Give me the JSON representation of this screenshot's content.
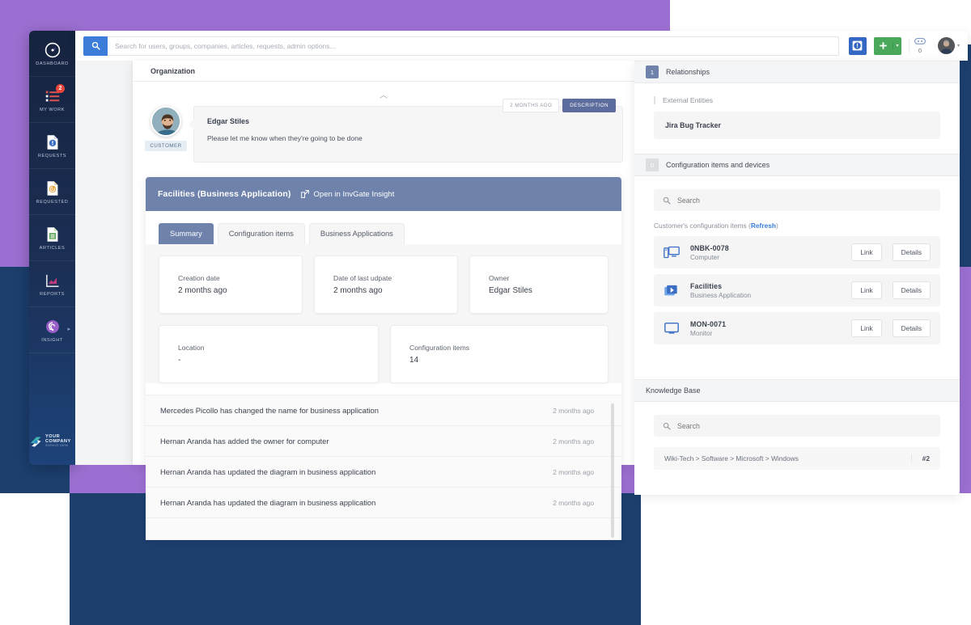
{
  "colors": {
    "bg_purple": "#9b6fd1",
    "bg_navy": "#1c3f6e",
    "accent_blue": "#3b7dd8",
    "panel_header_blue": "#6e82ab",
    "add_green": "#4aa85a",
    "badge_red": "#e8443a"
  },
  "sidebar": {
    "items": [
      {
        "label": "DASHBOARD",
        "icon": "speedometer-icon",
        "badge": null
      },
      {
        "label": "MY WORK",
        "icon": "task-list-icon",
        "badge": "2"
      },
      {
        "label": "REQUESTS",
        "icon": "request-document-icon",
        "badge": null
      },
      {
        "label": "REQUESTED",
        "icon": "requested-document-icon",
        "badge": null
      },
      {
        "label": "ARTICLES",
        "icon": "article-document-icon",
        "badge": null
      },
      {
        "label": "REPORTS",
        "icon": "chart-report-icon",
        "badge": null
      },
      {
        "label": "INSIGHT",
        "icon": "insight-circle-icon",
        "badge": null
      }
    ],
    "company": {
      "name": "YOUR COMPANY",
      "tagline": "SERVICE DESK",
      "logo": "company-logo-icon"
    }
  },
  "topbar": {
    "search_placeholder": "Search for users, groups, companies, articles, requests, admin options...",
    "search_value": "",
    "search_icon": "search-icon",
    "info_button": "info-icon",
    "add_button": "plus-icon",
    "add_caret": "▾",
    "chat_icon": "chat-bubble-icon",
    "chat_count": "0",
    "avatar": "user-avatar",
    "avatar_caret": "▾"
  },
  "main": {
    "organization_label": "Organization",
    "collapse_icon": "chevron-up-icon",
    "comment": {
      "author": "Edgar Stiles",
      "text": "Please let me know when they're going to be done",
      "role_tag": "CUSTOMER",
      "time": "2 MONTHS AGO",
      "kind": "DESCRIPTION",
      "avatar": "customer-avatar"
    },
    "facilities": {
      "title": "Facilities (Business Application)",
      "open_link": "Open in InvGate Insight",
      "open_link_icon": "external-link-icon",
      "tabs": [
        {
          "label": "Summary",
          "active": true
        },
        {
          "label": "Configuration items",
          "active": false
        },
        {
          "label": "Business Applications",
          "active": false
        }
      ],
      "cards": [
        {
          "key": "Creation date",
          "value": "2 months ago"
        },
        {
          "key": "Date of last udpate",
          "value": "2 months ago"
        },
        {
          "key": "Owner",
          "value": "Edgar Stiles"
        },
        {
          "key": "Location",
          "value": "-"
        },
        {
          "key": "Configuration items",
          "value": "14"
        }
      ],
      "activity": [
        {
          "text": "Mercedes Picollo has changed the name for business application",
          "time": "2 months ago"
        },
        {
          "text": "Hernan Aranda has added the owner for computer",
          "time": "2 months ago"
        },
        {
          "text": "Hernan Aranda has updated the diagram in business application",
          "time": "2 months ago"
        },
        {
          "text": "Hernan Aranda has updated the diagram in business application",
          "time": "2 months ago"
        }
      ]
    }
  },
  "right_panel": {
    "relationships": {
      "title": "Relationships",
      "count": "1",
      "sub_label": "External Entities",
      "entity": "Jira Bug Tracker"
    },
    "config_items": {
      "title": "Configuration items and devices",
      "count": "0",
      "search_placeholder": "Search",
      "search_icon": "search-icon",
      "list_label_prefix": "Customer's configuration items (",
      "refresh_label": "Refresh",
      "list_label_suffix": ")",
      "rows": [
        {
          "name": "0NBK-0078",
          "type": "Computer",
          "icon": "desktop-computer-icon",
          "link": "Link",
          "details": "Details"
        },
        {
          "name": "Facilities",
          "type": "Business Application",
          "icon": "business-app-icon",
          "link": "Link",
          "details": "Details"
        },
        {
          "name": "MON-0071",
          "type": "Monitor",
          "icon": "monitor-icon",
          "link": "Link",
          "details": "Details"
        }
      ]
    },
    "knowledge_base": {
      "title": "Knowledge Base",
      "search_placeholder": "Search",
      "search_icon": "search-icon",
      "result_path": "Wiki-Tech > Software > Microsoft > Windows",
      "result_num": "#2"
    }
  }
}
